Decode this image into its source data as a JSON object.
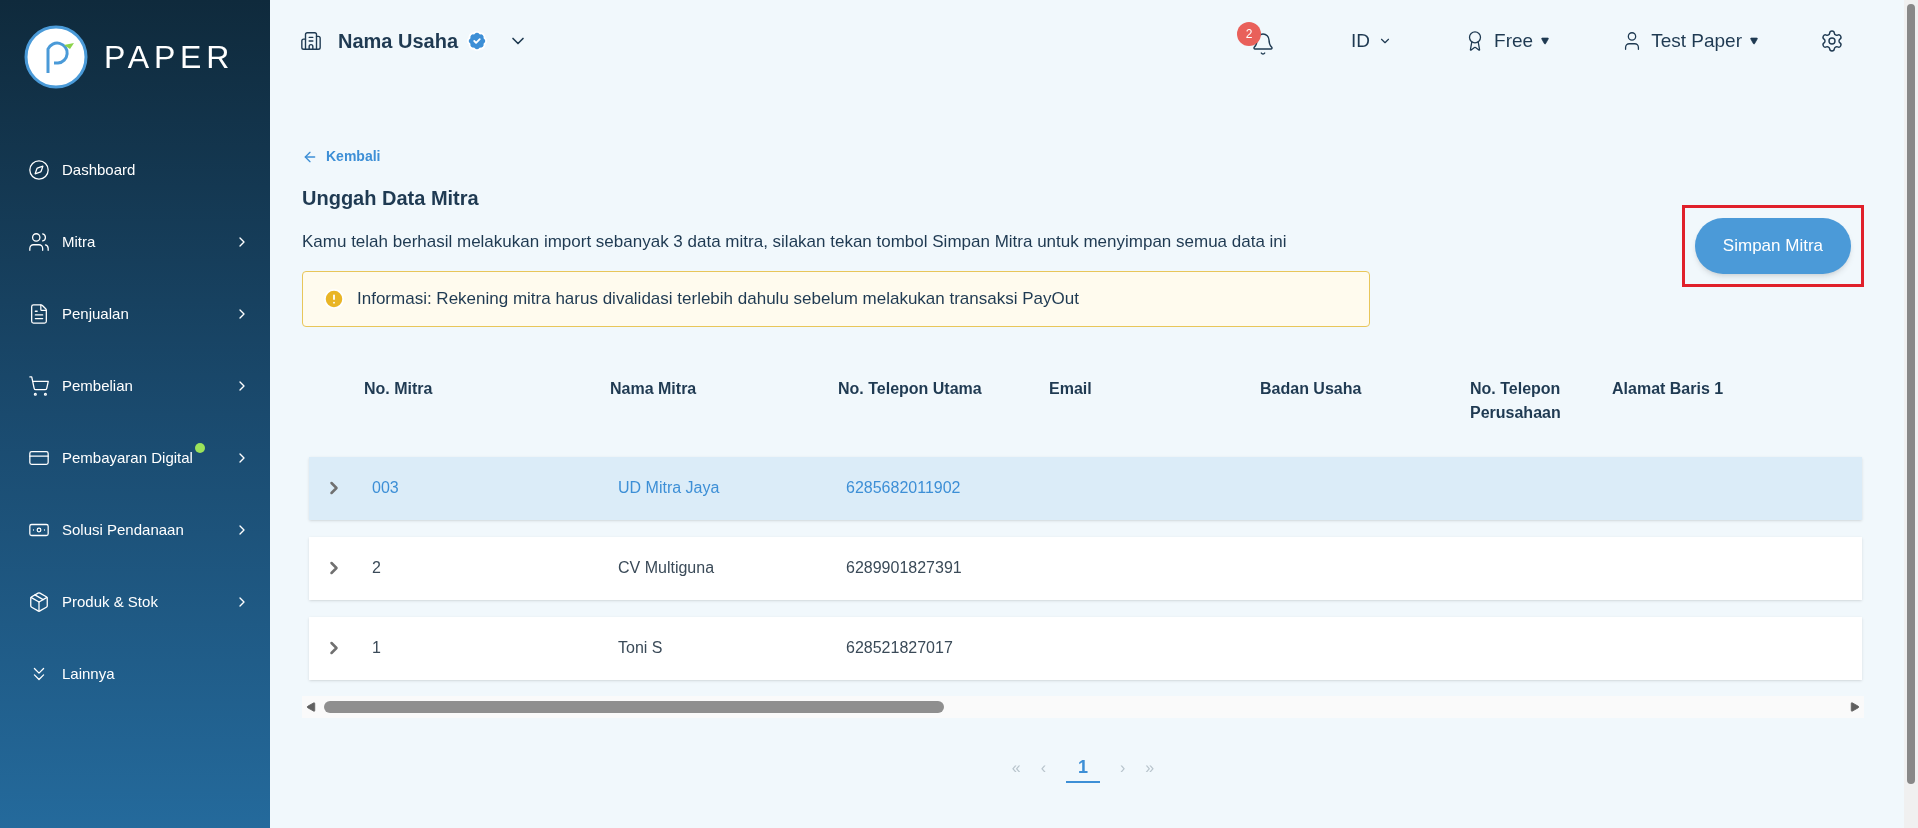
{
  "brand": {
    "name": "PAPER"
  },
  "sidebar": {
    "items": [
      {
        "label": "Dashboard",
        "expandable": false,
        "notification": false
      },
      {
        "label": "Mitra",
        "expandable": true,
        "notification": false
      },
      {
        "label": "Penjualan",
        "expandable": true,
        "notification": false
      },
      {
        "label": "Pembelian",
        "expandable": true,
        "notification": false
      },
      {
        "label": "Pembayaran Digital",
        "expandable": true,
        "notification": true
      },
      {
        "label": "Solusi Pendanaan",
        "expandable": true,
        "notification": false
      },
      {
        "label": "Produk & Stok",
        "expandable": true,
        "notification": false
      },
      {
        "label": "Lainnya",
        "expandable": false,
        "notification": false
      }
    ]
  },
  "header": {
    "business": "Nama Usaha",
    "verified": true,
    "notification_count": "2",
    "language": "ID",
    "plan": "Free",
    "user": "Test Paper"
  },
  "back_link": "Kembali",
  "title": "Unggah Data Mitra",
  "description": "Kamu telah berhasil melakukan import sebanyak 3 data mitra, silakan tekan tombol Simpan Mitra untuk menyimpan semua data ini",
  "info": "Informasi: Rekening mitra harus divalidasi terlebih dahulu sebelum melakukan transaksi PayOut",
  "save_button": {
    "label": "Simpan Mitra",
    "highlighted": true
  },
  "table": {
    "columns": [
      "No. Mitra",
      "Nama Mitra",
      "No. Telepon Utama",
      "Email",
      "Badan Usaha",
      "No. Telepon Perusahaan",
      "Alamat Baris 1"
    ],
    "rows": [
      {
        "selected": true,
        "cells": [
          "003",
          "UD Mitra Jaya",
          "6285682011902"
        ]
      },
      {
        "selected": false,
        "cells": [
          "2",
          "CV Multiguna",
          "6289901827391"
        ]
      },
      {
        "selected": false,
        "cells": [
          "1",
          "Toni S",
          "628521827017"
        ]
      }
    ]
  },
  "pagination": [
    {
      "label": "«",
      "selected": false
    },
    {
      "label": "‹",
      "selected": false
    },
    {
      "label": "1",
      "selected": true
    },
    {
      "label": "›",
      "selected": false
    },
    {
      "label": "»",
      "selected": false
    }
  ]
}
